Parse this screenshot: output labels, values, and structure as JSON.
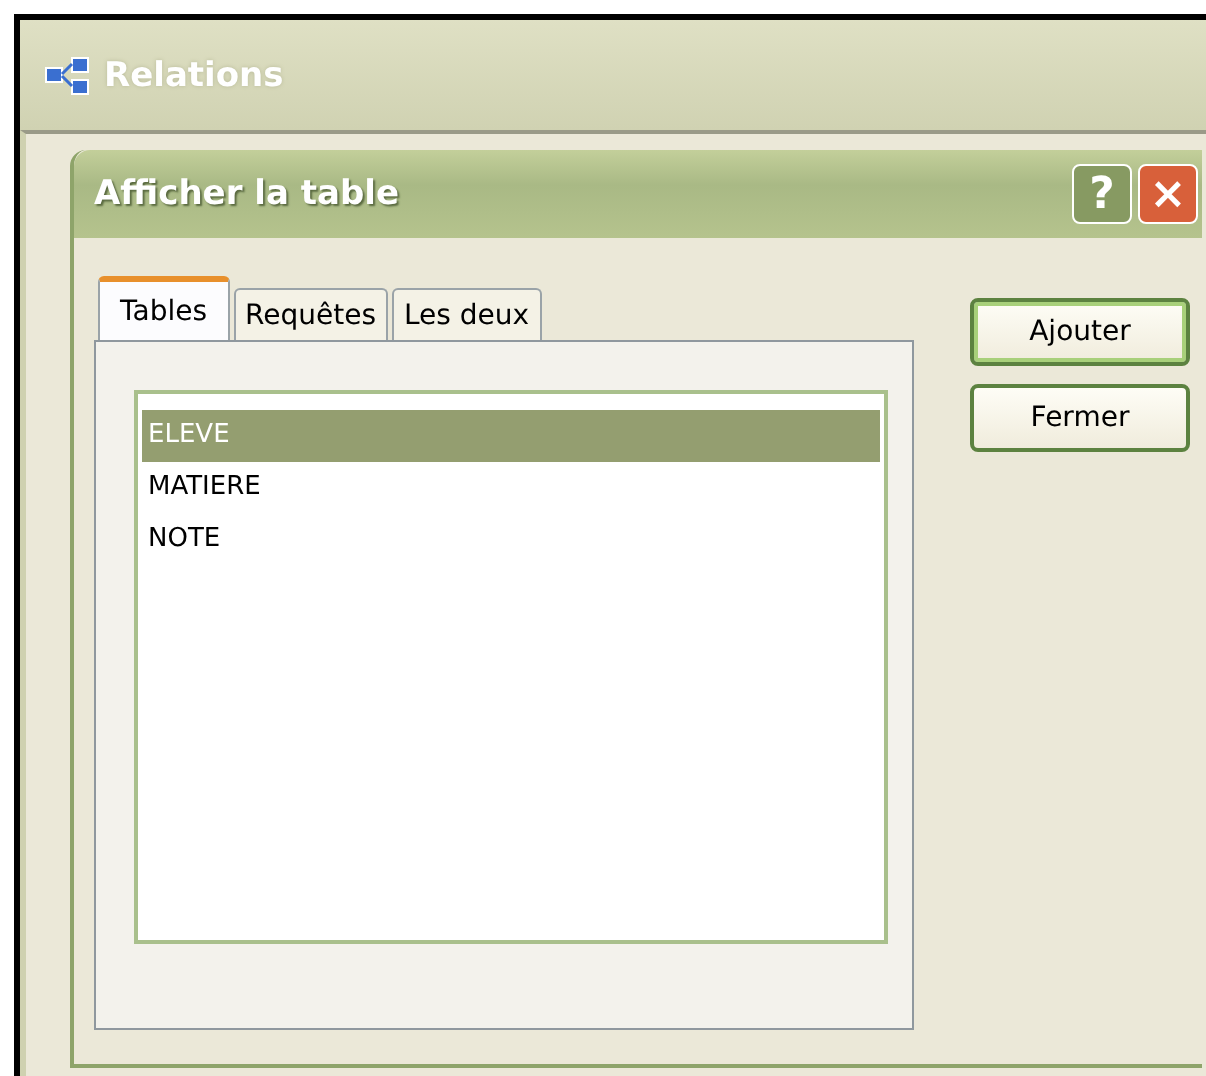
{
  "window": {
    "title": "Relations"
  },
  "dialog": {
    "title": "Afficher la table",
    "help": "?",
    "close": "×"
  },
  "tabs": [
    {
      "label": "Tables",
      "selected": true
    },
    {
      "label": "Requêtes",
      "selected": false
    },
    {
      "label": "Les deux",
      "selected": false
    }
  ],
  "list": [
    {
      "label": "ELEVE",
      "selected": true
    },
    {
      "label": "MATIERE",
      "selected": false
    },
    {
      "label": "NOTE",
      "selected": false
    }
  ],
  "buttons": [
    {
      "label": "Ajouter",
      "default": true
    },
    {
      "label": "Fermer",
      "default": false
    }
  ]
}
